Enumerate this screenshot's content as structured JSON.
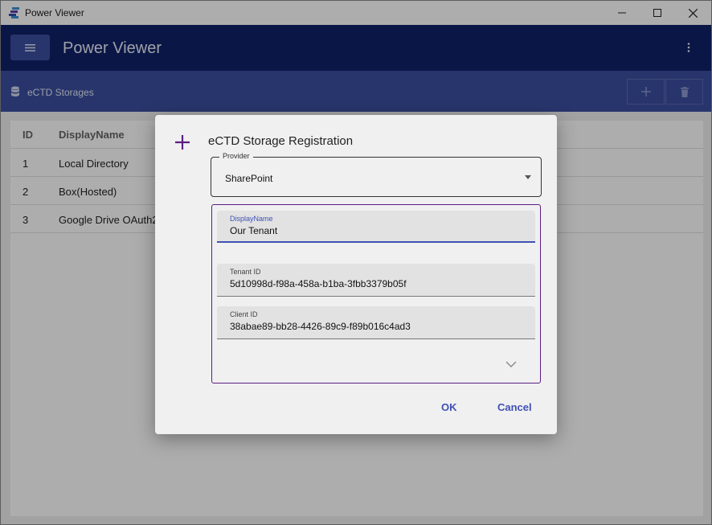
{
  "window": {
    "title": "Power Viewer"
  },
  "appbar": {
    "title": "Power Viewer"
  },
  "subbar": {
    "title": "eCTD Storages"
  },
  "grid": {
    "columns": {
      "id": "ID",
      "name": "DisplayName"
    },
    "rows": [
      {
        "id": "1",
        "name": "Local Directory"
      },
      {
        "id": "2",
        "name": "Box(Hosted)"
      },
      {
        "id": "3",
        "name": "Google Drive OAuth2"
      }
    ]
  },
  "dialog": {
    "title": "eCTD Storage Registration",
    "provider": {
      "label": "Provider",
      "value": "SharePoint"
    },
    "fields": {
      "display_name": {
        "label": "DisplayName",
        "value": "Our Tenant"
      },
      "tenant_id": {
        "label": "Tenant ID",
        "value": "5d10998d-f98a-458a-b1ba-3fbb3379b05f"
      },
      "client_id": {
        "label": "Client ID",
        "value": "38abae89-bb28-4426-89c9-f89b016c4ad3"
      }
    },
    "ok_label": "OK",
    "cancel_label": "Cancel"
  },
  "colors": {
    "appbar": "#0f2167",
    "subbar": "#3b4ea0",
    "accent": "#3f51b5",
    "dialog_icon": "#5b1d84"
  },
  "icons": [
    "app-logo-icon",
    "minimize-icon",
    "maximize-icon",
    "close-icon",
    "hamburger-menu-icon",
    "more-vertical-icon",
    "database-icon",
    "add-icon",
    "delete-icon",
    "plus-icon",
    "dropdown-arrow-icon",
    "chevron-down-icon"
  ]
}
